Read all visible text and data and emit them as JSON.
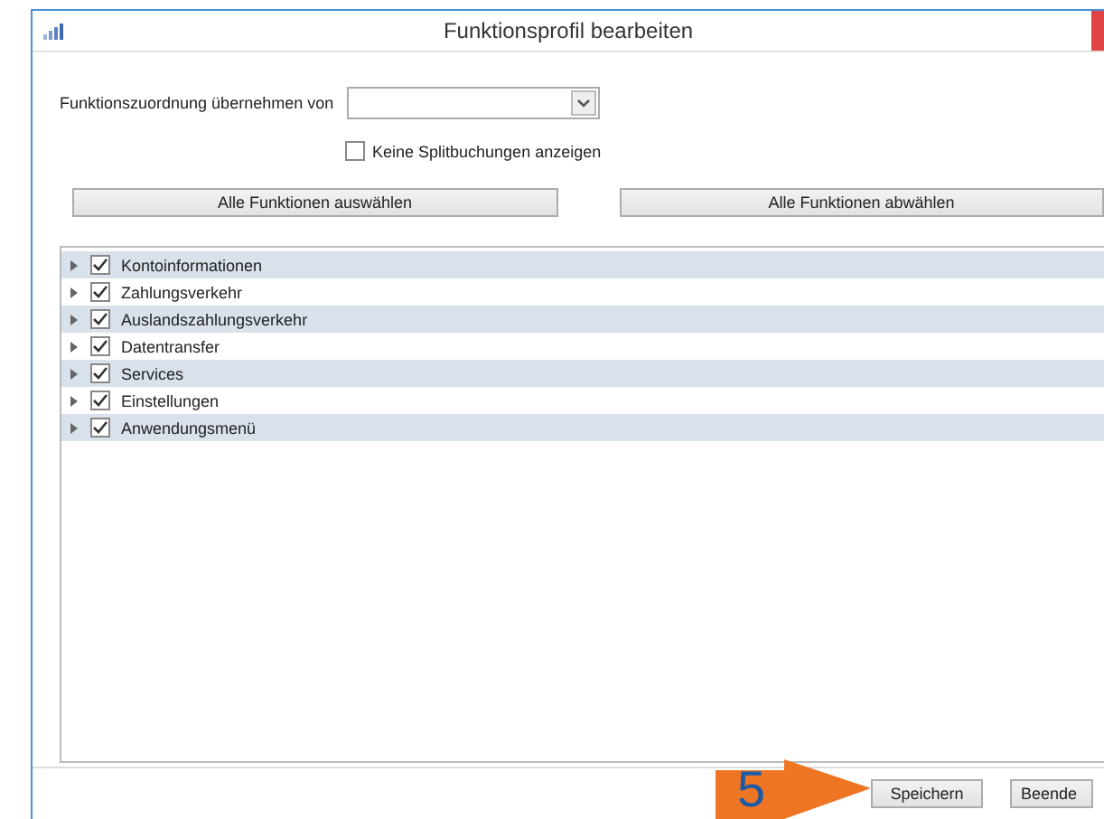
{
  "window": {
    "title": "Funktionsprofil bearbeiten"
  },
  "copy_from": {
    "label": "Funktionszuordnung übernehmen von"
  },
  "hide_split": {
    "label": "Keine Splitbuchungen anzeigen",
    "checked": false
  },
  "select_buttons": [
    "Alle Funktionen auswählen",
    "Alle Funktionen abwählen"
  ],
  "tree": [
    {
      "label": "Kontoinformationen",
      "checked": true,
      "expanded": false
    },
    {
      "label": "Zahlungsverkehr",
      "checked": true,
      "expanded": false
    },
    {
      "label": "Auslandszahlungsverkehr",
      "checked": true,
      "expanded": false
    },
    {
      "label": "Datentransfer",
      "checked": true,
      "expanded": false
    },
    {
      "label": "Services",
      "checked": true,
      "expanded": false
    },
    {
      "label": "Einstellungen",
      "checked": true,
      "expanded": false
    },
    {
      "label": "Anwendungsmenü",
      "checked": true,
      "expanded": false
    }
  ],
  "buttons": [
    "Speichern",
    "Beende"
  ],
  "annotation": {
    "number": "5"
  }
}
